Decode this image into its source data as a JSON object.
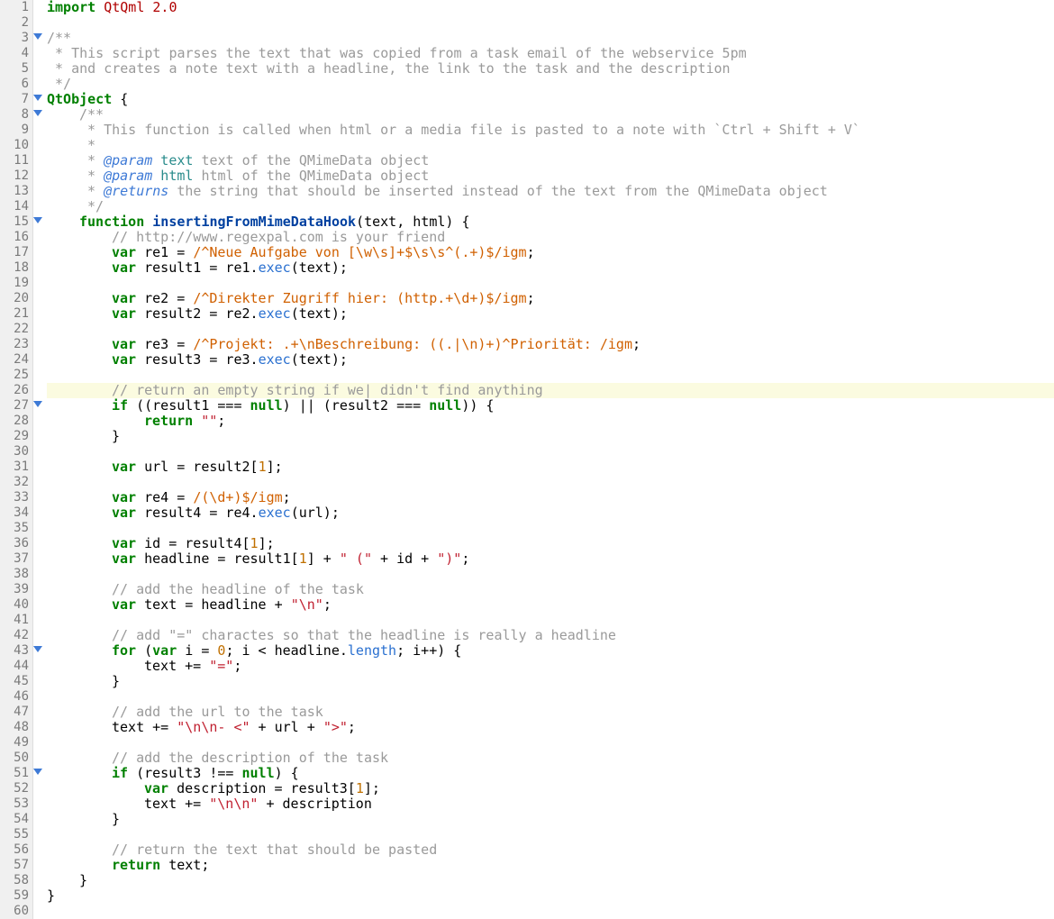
{
  "editor": {
    "line_count": 60,
    "current_line": 26,
    "fold_lines": [
      3,
      7,
      8,
      15,
      27,
      43,
      51
    ]
  },
  "code": {
    "l1_import": "import",
    "l1_mod": " QtQml ",
    "l1_ver": "2.0",
    "l3": "/**",
    "l4": " * This script parses the text that was copied from a task email of the webservice 5pm",
    "l5": " * and creates a note text with a headline, the link to the task and the description",
    "l6": " */",
    "l7_qt": "QtObject",
    "l7_brace": " {",
    "l8": "/**",
    "l9": " * This function is called when html or a media file is pasted to a note with `Ctrl + Shift + V`",
    "l10": " *",
    "l11a": " * ",
    "l11b": "@param",
    "l11c": " text",
    "l11d": " text of the QMimeData object",
    "l12c": " html",
    "l12d": " html of the QMimeData object",
    "l13b": "@returns",
    "l13d": " the string that should be inserted instead of the text from the QMimeData object",
    "l14": " */",
    "l15_fn": "function",
    "l15_name": " insertingFromMimeDataHook",
    "l15_args": "(text, html) {",
    "l16": "// http://www.regexpal.com is your friend",
    "l17a": "var",
    "l17b": " re1 = ",
    "l17_rx": "/^Neue Aufgabe von [\\w\\s]+$\\s\\s^(.+)$/igm",
    "l17c": ";",
    "l18a": "var",
    "l18b": " result1 = re1.",
    "l18c": "exec",
    "l18d": "(text);",
    "l20b": " re2 = ",
    "l20_rx": "/^Direkter Zugriff hier: (http.+\\d+)$/igm",
    "l21b": " result2 = re2.",
    "l23b": " re3 = ",
    "l23_rx": "/^Projekt: .+\\nBeschreibung: ((.|\\n)+)^Priorität: /igm",
    "l24b": " result3 = re3.",
    "l26": "// return an empty string if we| didn't find anything",
    "l27a": "if",
    "l27b": " ((result1 === ",
    "l27c": "null",
    "l27d": ") || (result2 === ",
    "l27e": ") {",
    "l28a": "return",
    "l28b": " \"\"",
    "l28c": ";",
    "l29": "}",
    "l31a": "var",
    "l31b": " url = result2[",
    "l31c": "1",
    "l31d": "];",
    "l33b": " re4 = ",
    "l33_rx": "/(\\d+)$/igm",
    "l34b": " result4 = re4.",
    "l36a": "var",
    "l36b": " id = result4[",
    "l37b": " headline = result1[",
    "l37c": "] + ",
    "l37d": "\" (\"",
    "l37e": " + id + ",
    "l37f": "\")\"",
    "l37g": ";",
    "l39": "// add the headline of the task",
    "l40b": " text = headline + ",
    "l40c": "\"\\n\"",
    "l42": "// add \"=\" charactes so that the headline is really a headline",
    "l43a": "for",
    "l43b": " (",
    "l43c": "var",
    "l43d": " i = ",
    "l43e": "0",
    "l43f": "; i < headline.",
    "l43g": "length",
    "l43h": "; i++) {",
    "l44a": "text += ",
    "l44b": "\"=\"",
    "l47": "// add the url to the task",
    "l48a": "text += ",
    "l48b": "\"\\n\\n- <\"",
    "l48c": " + url + ",
    "l48d": "\">\"",
    "l50": "// add the description of the task",
    "l51a": "if",
    "l51b": " (result3 !== ",
    "l51c": "null",
    "l51d": ") {",
    "l52a": "var",
    "l52b": " description = result3[",
    "l53a": "text += ",
    "l53b": "\"\\n\\n\"",
    "l53c": " + description",
    "l56": "// return the text that should be pasted",
    "l57a": "return",
    "l57b": " text;",
    "l58": "}",
    "l59": "}"
  }
}
